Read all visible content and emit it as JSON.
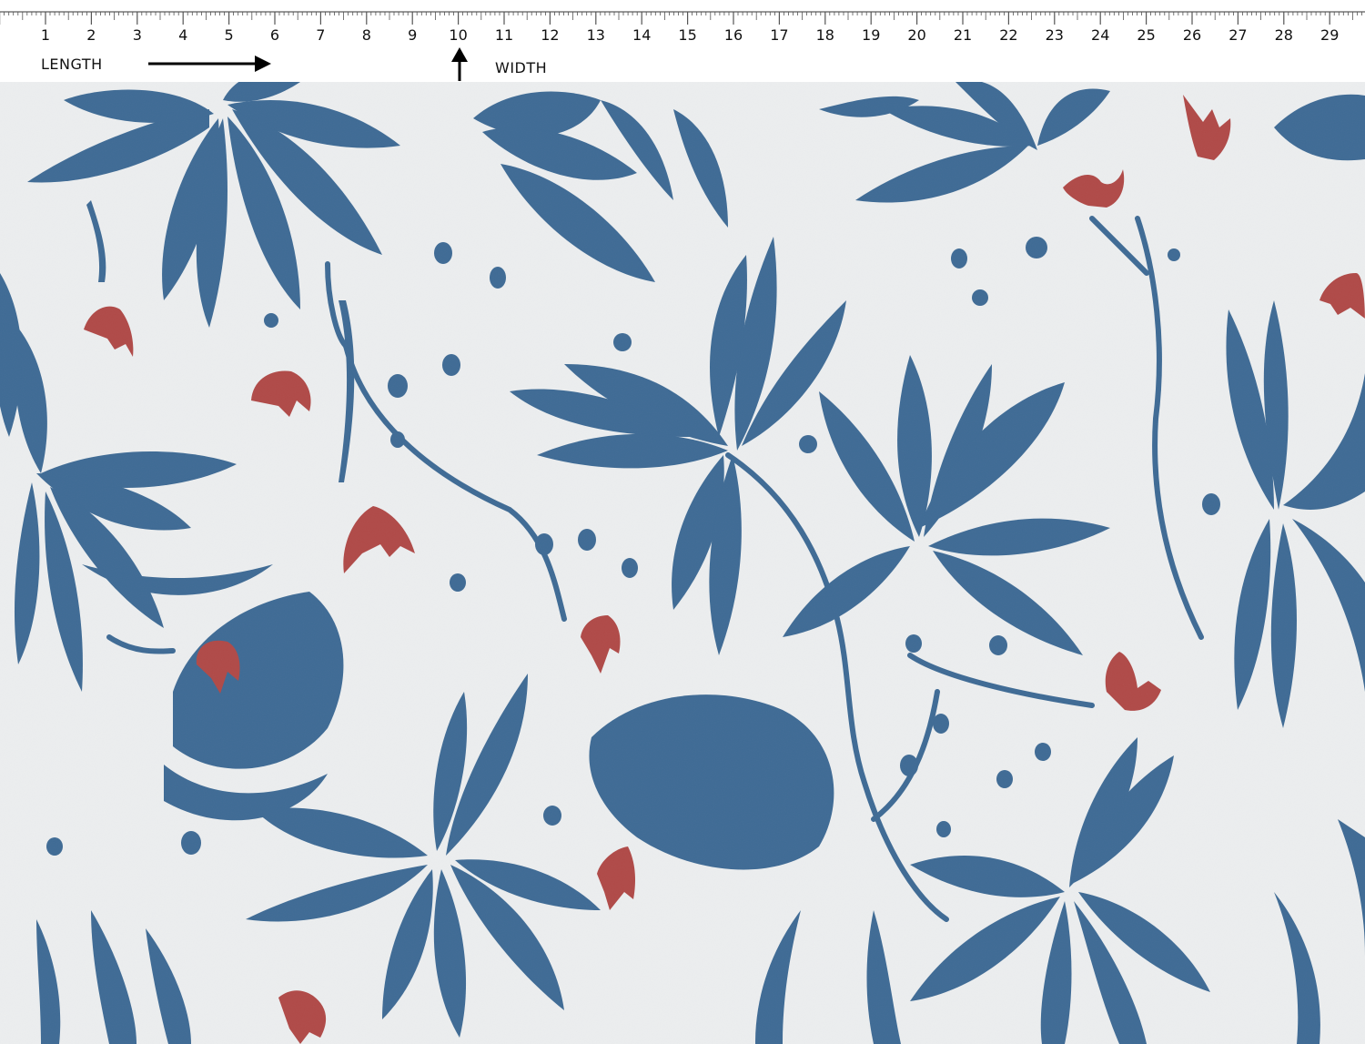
{
  "ruler": {
    "numbers": [
      "1",
      "2",
      "3",
      "4",
      "5",
      "6",
      "7",
      "8",
      "9",
      "10",
      "11",
      "12",
      "13",
      "14",
      "15",
      "16",
      "17",
      "18",
      "19",
      "20",
      "21",
      "22",
      "23",
      "24",
      "25",
      "26",
      "27",
      "28",
      "29"
    ],
    "length_label": "LENGTH",
    "width_label": "WIDTH"
  },
  "fabric": {
    "background_color": "#eceeef",
    "leaf_color": "#3f6b95",
    "bud_color": "#b04a48",
    "pattern": "blue-leaf-floral-print"
  }
}
